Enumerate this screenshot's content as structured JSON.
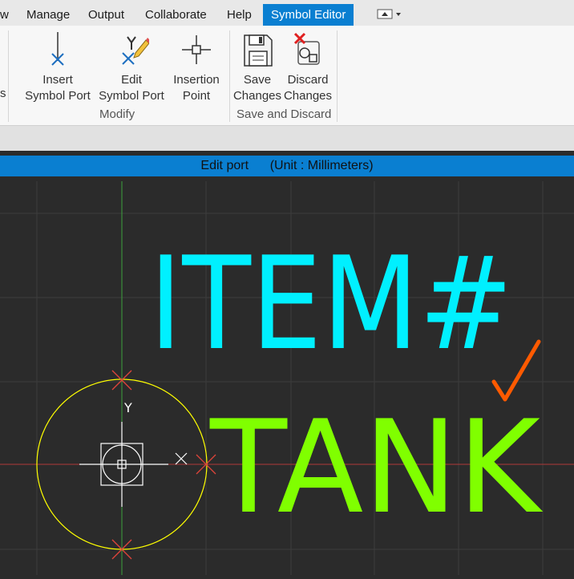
{
  "tabs": [
    {
      "label": "w",
      "active": false
    },
    {
      "label": "Manage",
      "active": false
    },
    {
      "label": "Output",
      "active": false
    },
    {
      "label": "Collaborate",
      "active": false
    },
    {
      "label": "Help",
      "active": false
    },
    {
      "label": "Symbol Editor",
      "active": true
    }
  ],
  "ribbon": {
    "insert_symbol_port": {
      "line1": "Insert",
      "line2": "Symbol Port"
    },
    "edit_symbol_port": {
      "line1": "Edit",
      "line2": "Symbol Port"
    },
    "insertion_point": {
      "line1": "Insertion",
      "line2": "Point"
    },
    "save_changes": {
      "line1": "Save",
      "line2": "Changes"
    },
    "discard_changes": {
      "line1": "Discard",
      "line2": "Changes"
    },
    "group_modify": "Modify",
    "group_save_discard": "Save and Discard",
    "left_cut_text": "s"
  },
  "status": {
    "mode": "Edit port",
    "unit": "(Unit : Millimeters)"
  },
  "canvas": {
    "item_text": "ITEM#",
    "tank_text": "TANK",
    "y_axis_label": "Y",
    "x_axis_label": "X",
    "colors": {
      "item": "#00f0ff",
      "tank": "#80ff00",
      "circle": "#ffff00",
      "check": "#ff5a00",
      "port_marker": "#e0443a",
      "grid": "#3c3c3c",
      "axis_v": "#3ca03c",
      "axis_h": "#b03a3a",
      "accent": "#0a7fd1"
    }
  }
}
